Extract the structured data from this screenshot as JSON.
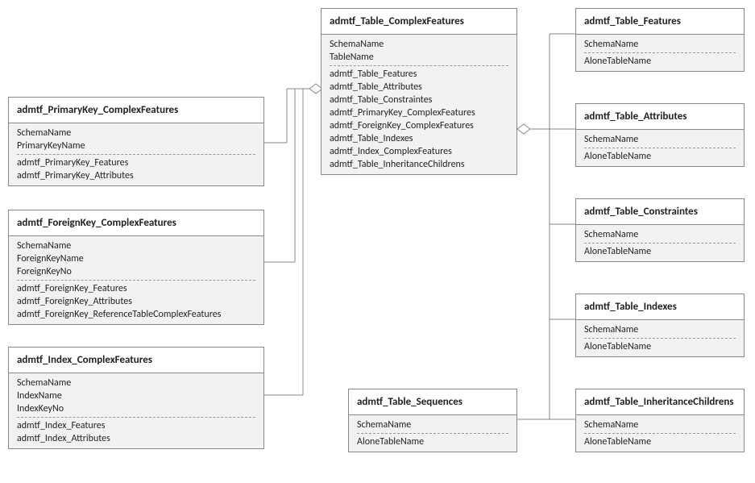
{
  "entities": {
    "complexFeatures": {
      "title": "admtf_Table_ComplexFeatures",
      "top": [
        "SchemaName",
        "TableName"
      ],
      "bottom": [
        "admtf_Table_Features",
        "admtf_Table_Attributes",
        "admtf_Table_Constraintes",
        "admtf_PrimaryKey_ComplexFeatures",
        "admtf_ForeignKey_ComplexFeatures",
        "admtf_Table_Indexes",
        "admtf_Index_ComplexFeatures",
        "admtf_Table_InheritanceChildrens"
      ]
    },
    "pkComplex": {
      "title": "admtf_PrimaryKey_ComplexFeatures",
      "top": [
        "SchemaName",
        "PrimaryKeyName"
      ],
      "bottom": [
        "admtf_PrimaryKey_Features",
        "admtf_PrimaryKey_Attributes"
      ]
    },
    "fkComplex": {
      "title": "admtf_ForeignKey_ComplexFeatures",
      "top": [
        "SchemaName",
        "ForeignKeyName",
        "ForeignKeyNo"
      ],
      "bottom": [
        "admtf_ForeignKey_Features",
        "admtf_ForeignKey_Attributes",
        "admtf_ForeignKey_ReferenceTableComplexFeatures"
      ]
    },
    "idxComplex": {
      "title": "admtf_Index_ComplexFeatures",
      "top": [
        "SchemaName",
        "IndexName",
        "IndexKeyNo"
      ],
      "bottom": [
        "admtf_Index_Features",
        "admtf_Index_Attributes"
      ]
    },
    "tblFeatures": {
      "title": "admtf_Table_Features",
      "top": [
        "SchemaName"
      ],
      "bottom": [
        "AloneTableName"
      ]
    },
    "tblAttributes": {
      "title": "admtf_Table_Attributes",
      "top": [
        "SchemaName"
      ],
      "bottom": [
        "AloneTableName"
      ]
    },
    "tblConstraintes": {
      "title": "admtf_Table_Constraintes",
      "top": [
        "SchemaName"
      ],
      "bottom": [
        "AloneTableName"
      ]
    },
    "tblIndexes": {
      "title": "admtf_Table_Indexes",
      "top": [
        "SchemaName"
      ],
      "bottom": [
        "AloneTableName"
      ]
    },
    "tblInheritance": {
      "title": "admtf_Table_InheritanceChildrens",
      "top": [
        "SchemaName"
      ],
      "bottom": [
        "AloneTableName"
      ]
    },
    "tblSequences": {
      "title": "admtf_Table_Sequences",
      "top": [
        "SchemaName"
      ],
      "bottom": [
        "AloneTableName"
      ]
    }
  }
}
